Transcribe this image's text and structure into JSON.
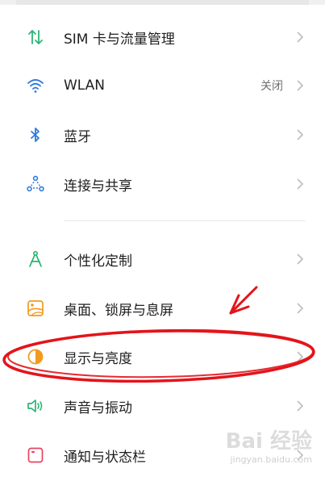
{
  "settings": {
    "items": [
      {
        "label": "SIM 卡与流量管理",
        "icon": "sim-data-icon",
        "value": ""
      },
      {
        "label": "WLAN",
        "icon": "wifi-icon",
        "value": "关闭"
      },
      {
        "label": "蓝牙",
        "icon": "bluetooth-icon",
        "value": ""
      },
      {
        "label": "连接与共享",
        "icon": "connection-share-icon",
        "value": ""
      },
      {
        "label": "个性化定制",
        "icon": "personalize-icon",
        "value": ""
      },
      {
        "label": "桌面、锁屏与息屏",
        "icon": "wallpaper-icon",
        "value": ""
      },
      {
        "label": "显示与亮度",
        "icon": "display-brightness-icon",
        "value": ""
      },
      {
        "label": "声音与振动",
        "icon": "sound-icon",
        "value": ""
      },
      {
        "label": "通知与状态栏",
        "icon": "notification-icon",
        "value": ""
      }
    ]
  },
  "watermark": {
    "text": "Bai 经验",
    "sub": "jingyan.baidu.com"
  },
  "colors": {
    "accent_green": "#2bb673",
    "accent_blue": "#2f7bd9",
    "accent_orange": "#f39a1e",
    "annotation_red": "#e3141b"
  }
}
